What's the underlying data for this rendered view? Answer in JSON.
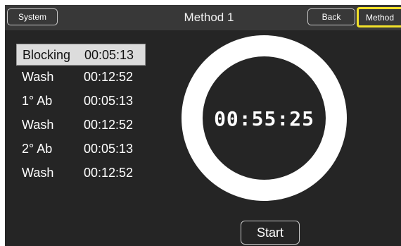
{
  "header": {
    "title": "Method 1",
    "system_label": "System",
    "back_label": "Back",
    "method_label": "Method"
  },
  "steps": [
    {
      "name": "Blocking",
      "time": "00:05:13",
      "selected": true
    },
    {
      "name": "Wash",
      "time": "00:12:52",
      "selected": false
    },
    {
      "name": "1° Ab",
      "time": "00:05:13",
      "selected": false
    },
    {
      "name": "Wash",
      "time": "00:12:52",
      "selected": false
    },
    {
      "name": "2° Ab",
      "time": "00:05:13",
      "selected": false
    },
    {
      "name": "Wash",
      "time": "00:12:52",
      "selected": false
    }
  ],
  "timer": {
    "display": "00:55:25"
  },
  "actions": {
    "start_label": "Start"
  },
  "colors": {
    "screen_background": "#252525",
    "topbar_background": "#383838",
    "method_highlight": "#f2e12a",
    "selected_row": "#dcdcdc",
    "ring": "#ffffff"
  }
}
